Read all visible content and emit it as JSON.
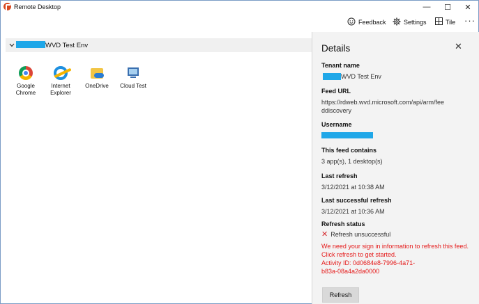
{
  "window": {
    "title": "Remote Desktop",
    "controls": {
      "minimize": "—",
      "maximize": "☐",
      "close": "✕"
    }
  },
  "commandbar": {
    "feedback_label": "Feedback",
    "settings_label": "Settings",
    "tile_label": "Tile",
    "more_label": "···"
  },
  "group": {
    "title_visible": "WVD Test Env",
    "chevron": "⌄"
  },
  "apps": [
    {
      "label": "Google Chrome",
      "icon": "chrome-icon"
    },
    {
      "label": "Internet Explorer",
      "icon": "internet-explorer-icon"
    },
    {
      "label": "OneDrive",
      "icon": "onedrive-icon"
    },
    {
      "label": "Cloud Test",
      "icon": "desktop-icon"
    }
  ],
  "details": {
    "title": "Details",
    "close_glyph": "✕",
    "tenant_name_label": "Tenant name",
    "tenant_name_visible": "WVD Test Env",
    "feed_url_label": "Feed URL",
    "feed_url_value": "https://rdweb.wvd.microsoft.com/api/arm/feeddiscovery",
    "username_label": "Username",
    "feed_contains_label": "This feed contains",
    "feed_contains_value": "3 app(s), 1 desktop(s)",
    "last_refresh_label": "Last refresh",
    "last_refresh_value": "3/12/2021 at 10:38 AM",
    "last_success_label": "Last successful refresh",
    "last_success_value": "3/12/2021 at 10:36 AM",
    "refresh_status_label": "Refresh status",
    "refresh_status_value": "Refresh unsuccessful",
    "error_message": "We need your sign in information to refresh this feed.  Click refresh to get started.",
    "activity_id": "Activity ID: 0d0684e8-7996-4a71-b83a-08a4a2da0000",
    "refresh_button": "Refresh"
  },
  "colors": {
    "accent": "#e51a1a",
    "redaction": "#1fa7e8",
    "pane_background": "#f3f3f3"
  }
}
